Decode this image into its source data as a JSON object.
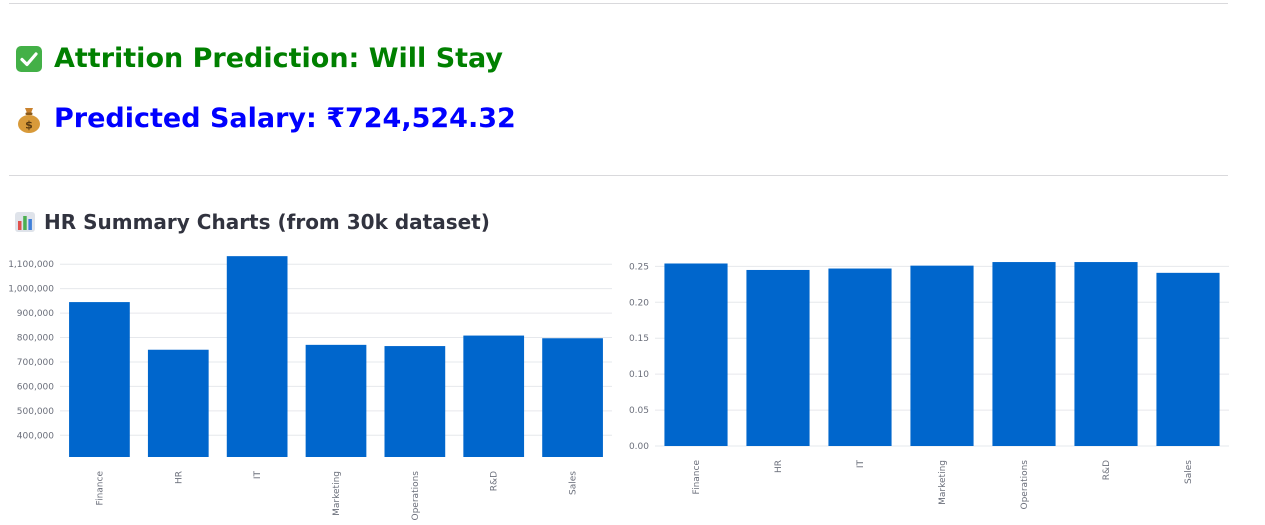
{
  "prediction": {
    "label": "Attrition Prediction: Will Stay",
    "icon": "check-mark-button-icon",
    "color": "#008000"
  },
  "salary": {
    "label": "Predicted Salary: ₹724,524.32",
    "icon": "money-bag-icon",
    "color": "#0000ff"
  },
  "section": {
    "title": "HR Summary Charts (from 30k dataset)",
    "icon": "bar-chart-icon"
  },
  "colors": {
    "bar": "#0066cc",
    "grid": "#e6e8ec",
    "tick": "#6b6f7b"
  },
  "chart_data": [
    {
      "type": "bar",
      "categories": [
        "Finance",
        "HR",
        "IT",
        "Marketing",
        "Operations",
        "R&D",
        "Sales"
      ],
      "values": [
        945000,
        750000,
        1133000,
        770000,
        765000,
        808000,
        797000
      ],
      "title": "",
      "xlabel": "",
      "ylabel": "",
      "ylim": [
        311000,
        1150000
      ],
      "yticks": [
        400000,
        500000,
        600000,
        700000,
        800000,
        900000,
        1000000,
        1100000
      ],
      "ytick_labels": [
        "400,000",
        "500,000",
        "600,000",
        "700,000",
        "800,000",
        "900,000",
        "1,000,000",
        "1,100,000"
      ],
      "grid": true,
      "legend": "none"
    },
    {
      "type": "bar",
      "categories": [
        "Finance",
        "HR",
        "IT",
        "Marketing",
        "Operations",
        "R&D",
        "Sales"
      ],
      "values": [
        0.254,
        0.245,
        0.247,
        0.251,
        0.256,
        0.256,
        0.241
      ],
      "title": "",
      "xlabel": "",
      "ylabel": "",
      "ylim": [
        0,
        0.27
      ],
      "yticks": [
        0,
        0.05,
        0.1,
        0.15,
        0.2,
        0.25
      ],
      "ytick_labels": [
        "0.00",
        "0.05",
        "0.10",
        "0.15",
        "0.20",
        "0.25"
      ],
      "grid": true,
      "legend": "none"
    }
  ]
}
